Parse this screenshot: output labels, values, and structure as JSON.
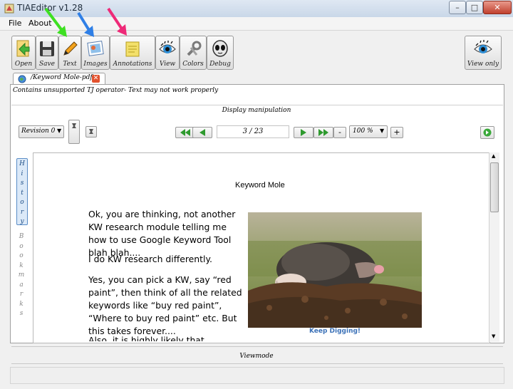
{
  "window": {
    "title": "TIAEditor v1.28"
  },
  "menu": {
    "file": "File",
    "about": "About"
  },
  "toolbar": {
    "open": "Open",
    "save": "Save",
    "text": "Text",
    "images": "Images",
    "annotations": "Annotations",
    "view": "View",
    "colors": "Colors",
    "debug": "Debug",
    "view_only": "View only"
  },
  "tab": {
    "label": "/Keyword Mole-pdf"
  },
  "warning": "Contains unsupported TJ operator- Text may not work properly",
  "display": {
    "label": "Display manipulation",
    "revision": "Revision 0",
    "page": "3 / 23",
    "zoom": "100 %",
    "minus": "-",
    "plus": "+"
  },
  "sidebar": {
    "history": [
      "H",
      "i",
      "s",
      "t",
      "o",
      "r",
      "y"
    ],
    "bookmarks": [
      "B",
      "o",
      "o",
      "k",
      "m",
      "a",
      "r",
      "k",
      "s"
    ]
  },
  "document": {
    "heading": "Keyword Mole",
    "paragraphs": [
      "Ok, you are thinking, not another KW research module telling me how to use Google Keyword Tool blah blah....",
      "I do KW research differently.",
      "Yes, you can pick a KW, say “red paint”, then think of all the related keywords like “buy red paint”, “Where to buy red paint” etc. But this takes forever....",
      "Also, it is highly likely that whatever niche"
    ],
    "caption": "Keep Digging!"
  },
  "status": {
    "viewmode": "Viewmode"
  },
  "colors": {
    "green_arrow": "#3ee022",
    "blue_arrow": "#2f7fe6",
    "pink_arrow": "#ee2a78"
  }
}
